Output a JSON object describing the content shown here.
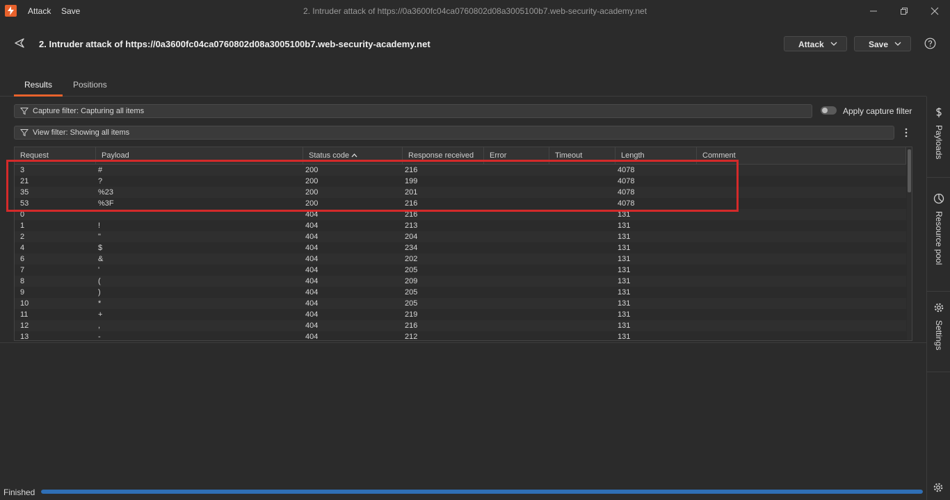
{
  "window": {
    "title": "2. Intruder attack of https://0a3600fc04ca0760802d08a3005100b7.web-security-academy.net",
    "menu": [
      "Attack",
      "Save"
    ]
  },
  "header": {
    "title": "2. Intruder attack of https://0a3600fc04ca0760802d08a3005100b7.web-security-academy.net",
    "attack_label": "Attack",
    "save_label": "Save"
  },
  "tabs": [
    {
      "label": "Results",
      "active": true
    },
    {
      "label": "Positions",
      "active": false
    }
  ],
  "filters": {
    "capture": "Capture filter: Capturing all items",
    "view": "View filter: Showing all items",
    "apply_capture_label": "Apply capture filter",
    "apply_capture_enabled": false
  },
  "table": {
    "columns": [
      "Request",
      "Payload",
      "Status code",
      "Response received",
      "Error",
      "Timeout",
      "Length",
      "Comment"
    ],
    "sorted_column": "Status code",
    "sort_direction": "ascending",
    "rows": [
      [
        "3",
        "#",
        "200",
        "216",
        "",
        "",
        "4078",
        ""
      ],
      [
        "21",
        "?",
        "200",
        "199",
        "",
        "",
        "4078",
        ""
      ],
      [
        "35",
        "%23",
        "200",
        "201",
        "",
        "",
        "4078",
        ""
      ],
      [
        "53",
        "%3F",
        "200",
        "216",
        "",
        "",
        "4078",
        ""
      ],
      [
        "0",
        "",
        "404",
        "216",
        "",
        "",
        "131",
        ""
      ],
      [
        "1",
        "!",
        "404",
        "213",
        "",
        "",
        "131",
        ""
      ],
      [
        "2",
        "\"",
        "404",
        "204",
        "",
        "",
        "131",
        ""
      ],
      [
        "4",
        "$",
        "404",
        "234",
        "",
        "",
        "131",
        ""
      ],
      [
        "6",
        "&",
        "404",
        "202",
        "",
        "",
        "131",
        ""
      ],
      [
        "7",
        "'",
        "404",
        "205",
        "",
        "",
        "131",
        ""
      ],
      [
        "8",
        "(",
        "404",
        "209",
        "",
        "",
        "131",
        ""
      ],
      [
        "9",
        ")",
        "404",
        "205",
        "",
        "",
        "131",
        ""
      ],
      [
        "10",
        "*",
        "404",
        "205",
        "",
        "",
        "131",
        ""
      ],
      [
        "11",
        "+",
        "404",
        "219",
        "",
        "",
        "131",
        ""
      ],
      [
        "12",
        ",",
        "404",
        "216",
        "",
        "",
        "131",
        ""
      ],
      [
        "13",
        "-",
        "404",
        "212",
        "",
        "",
        "131",
        ""
      ]
    ]
  },
  "sidebar": {
    "items": [
      {
        "label": "Payloads",
        "icon": "dollar-icon"
      },
      {
        "label": "Resource pool",
        "icon": "pie-chart-icon"
      },
      {
        "label": "Settings",
        "icon": "gear-icon"
      }
    ]
  },
  "status": {
    "text": "Finished",
    "progress": 1.0
  },
  "colors": {
    "accent": "#e8622c",
    "highlight": "#d42a2a",
    "progress": "#2f6fb5"
  }
}
